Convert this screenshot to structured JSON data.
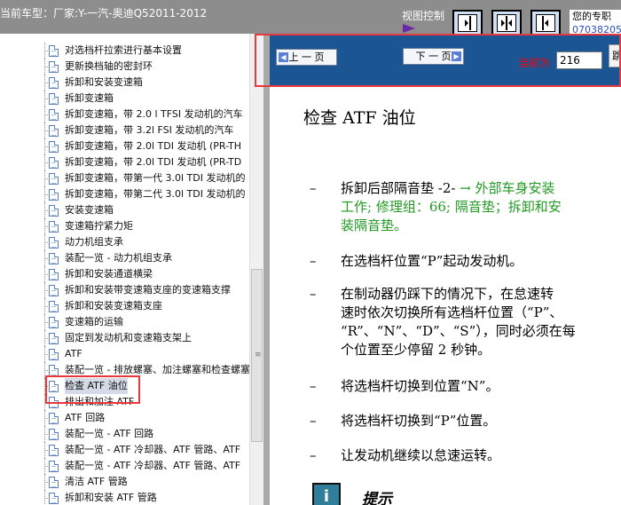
{
  "header": {
    "vehicle_title": "当前车型：厂家:Y-一汽-奥迪Q52011-2012",
    "view_control_label": "视图控制",
    "user_line1": "您的专职",
    "user_line2": "07038205"
  },
  "tree": {
    "items": [
      {
        "label": "对选档杆拉索进行基本设置"
      },
      {
        "label": "更新换档轴的密封环"
      },
      {
        "label": "拆卸和安装变速箱"
      },
      {
        "label": "拆卸变速箱"
      },
      {
        "label": "拆卸变速箱，带 2.0 l TFSI 发动机的汽车"
      },
      {
        "label": "拆卸变速箱，带 3.2l FSI 发动机的汽车"
      },
      {
        "label": "拆卸变速箱，带 2.0l TDI 发动机 (PR-TH"
      },
      {
        "label": "拆卸变速箱，带 2.0l TDI 发动机 (PR-TD"
      },
      {
        "label": "拆卸变速箱，带第一代 3.0l TDI 发动机的"
      },
      {
        "label": "拆卸变速箱，带第二代 3.0l TDI 发动机的"
      },
      {
        "label": "安装变速箱"
      },
      {
        "label": "变速箱拧紧力矩"
      },
      {
        "label": "动力机组支承"
      },
      {
        "label": "装配一览 - 动力机组支承"
      },
      {
        "label": "拆卸和安装通道横梁"
      },
      {
        "label": "拆卸和安装带变速箱支座的变速箱支撑"
      },
      {
        "label": "拆卸和安装变速箱支座"
      },
      {
        "label": "变速箱的运输"
      },
      {
        "label": "固定到发动机和变速箱支架上"
      },
      {
        "label": "ATF"
      },
      {
        "label": "装配一览 - 排放螺塞、加注螺塞和检查螺塞"
      },
      {
        "label": "检查 ATF 油位",
        "selected": true
      },
      {
        "label": "排出和加注 ATF"
      },
      {
        "label": "ATF 回路"
      },
      {
        "label": "装配一览 - ATF 回路"
      },
      {
        "label": "装配一览 - ATF 冷却器、ATF 管路、ATF"
      },
      {
        "label": "装配一览 - ATF 冷却器、ATF 管路、ATF"
      },
      {
        "label": "清洁 ATF 管路"
      },
      {
        "label": "拆卸和安装 ATF 管路"
      }
    ]
  },
  "nav": {
    "prev_label": "上 一 页",
    "next_label": "下 一 页",
    "current_label": "当前为",
    "current_page": "216",
    "go_label": "跳"
  },
  "content": {
    "title": "检查  ATF 油位",
    "dash": "–",
    "step1_a": "拆卸后部隔音垫 -2- ",
    "step1_b": "→ 外部车身安装",
    "step1_line2": "工作; 修理组：66; 隔音垫；拆卸和安",
    "step1_line3": "装隔音垫。",
    "step2": "在选档杆位置“P”起动发动机。",
    "step3_line1": "在制动器仍踩下的情况下，在怠速转",
    "step3_line2": "速时依次切换所有选档杆位置（“P”、",
    "step3_line3": "“R”、“N”、“D”、“S”），同时必须在每",
    "step3_line4": "个位置至少停留 2 秒钟。",
    "step4": "将选档杆切换到位置“N”。",
    "step5": "将选档杆切换到“P”位置。",
    "step6": "让发动机继续以怠速运转。",
    "tip_icon": "i",
    "tip_label": "提示"
  },
  "colors": {
    "header_bg": "#8d8d8d",
    "navbar_bg": "#1b5593",
    "highlight": "#e8383d",
    "link_green": "#229922"
  }
}
